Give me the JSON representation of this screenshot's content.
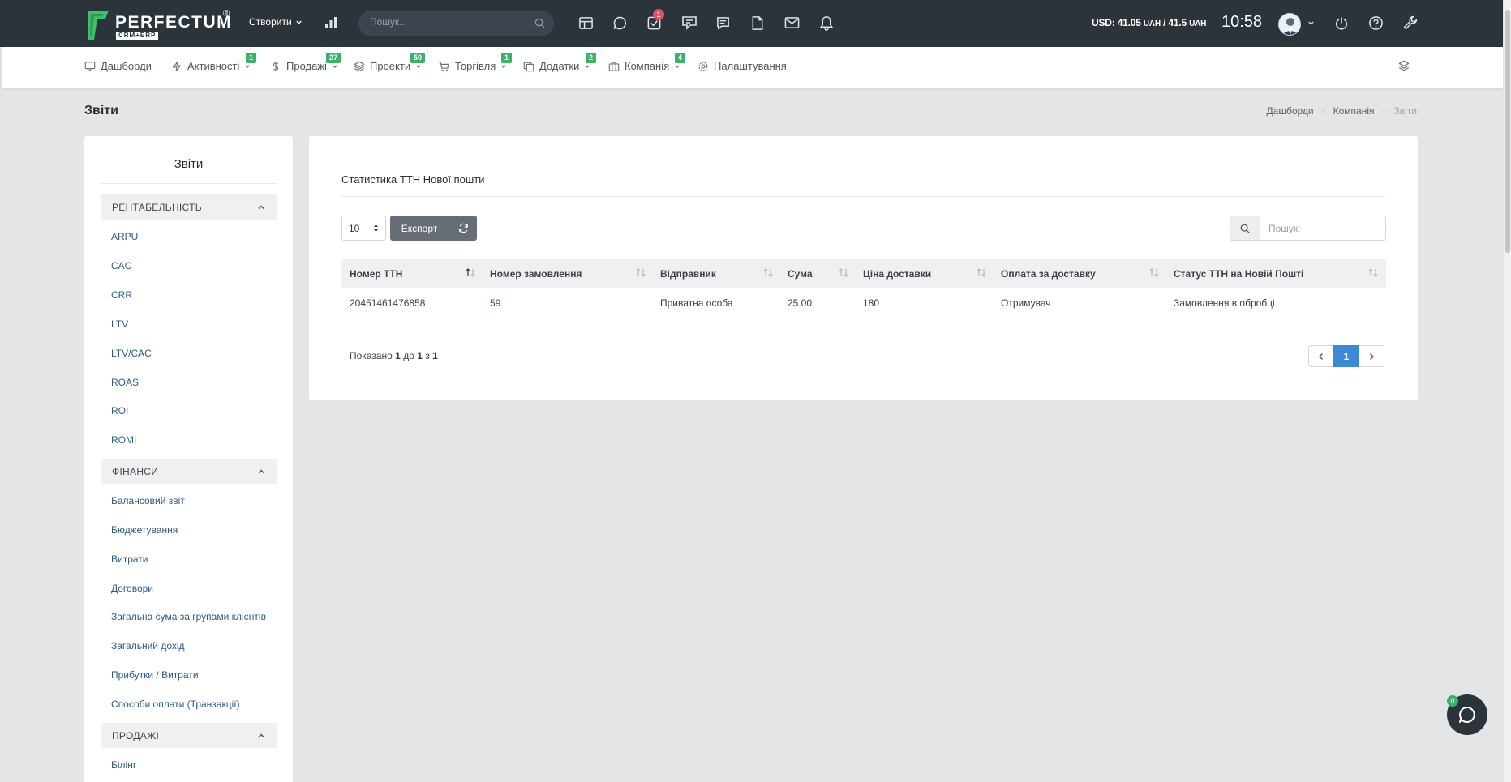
{
  "header": {
    "logo_text": "PERFECTUM",
    "logo_sub": "CRM+ERP",
    "logo_reg": "®",
    "create_label": "Створити",
    "search_placeholder": "Пошук...",
    "tasks_badge": "1",
    "currency_label": "USD:",
    "currency_buy": "41.05",
    "currency_sep": "/",
    "currency_sell": "41.5",
    "currency_unit": "UAH",
    "time": "10:58"
  },
  "nav": [
    {
      "label": "Дашборди",
      "icon": "monitor-icon",
      "badge": ""
    },
    {
      "label": "Активності",
      "icon": "bolt-icon",
      "badge": "1"
    },
    {
      "label": "Продажі",
      "icon": "dollar-icon",
      "badge": "27"
    },
    {
      "label": "Проекти",
      "icon": "layers-icon",
      "badge": "50"
    },
    {
      "label": "Торгівля",
      "icon": "cart-icon",
      "badge": "1"
    },
    {
      "label": "Додатки",
      "icon": "copy-icon",
      "badge": "2"
    },
    {
      "label": "Компанія",
      "icon": "briefcase-icon",
      "badge": "4"
    },
    {
      "label": "Налаштування",
      "icon": "gear-icon",
      "badge": ""
    }
  ],
  "page": {
    "title": "Звіти",
    "breadcrumb": [
      "Дашборди",
      "Компанія",
      "Звіти"
    ]
  },
  "sidebar": {
    "title": "Звіти",
    "groups": [
      {
        "name": "РЕНТАБЕЛЬНІСТЬ",
        "items": [
          "ARPU",
          "CAC",
          "CRR",
          "LTV",
          "LTV/CAC",
          "ROAS",
          "ROI",
          "ROMI"
        ]
      },
      {
        "name": "ФІНАНСИ",
        "items": [
          "Балансовий звіт",
          "Бюджетування",
          "Витрати",
          "Договори",
          "Загальна сума за групами клієнтів",
          "Загальний дохід",
          "Прибутки / Витрати",
          "Способи оплати (Транзакції)"
        ]
      },
      {
        "name": "ПРОДАЖІ",
        "items": [
          "Білінг"
        ]
      }
    ]
  },
  "report": {
    "title": "Статистика ТТН Нової пошти",
    "page_length": "10",
    "export_label": "Експорт",
    "search_placeholder": "Пошук:",
    "columns": [
      "Номер ТТН",
      "Номер замовлення",
      "Відправник",
      "Сума",
      "Ціна доставки",
      "Оплата за доставку",
      "Статус ТТН на Новій Пошті"
    ],
    "rows": [
      [
        "20451461476858",
        "59",
        "Приватна особа",
        "25.00",
        "180",
        "Отримувач",
        "Замовлення в обробці"
      ]
    ],
    "info_prefix": "Показано",
    "info_from": "1",
    "info_to_word": "до",
    "info_to": "1",
    "info_of_word": "з",
    "info_total": "1",
    "current_page": "1"
  },
  "chat": {
    "badge": "0"
  },
  "colors": {
    "topbar": "#2b333b",
    "accent": "#3a8ad6",
    "badge_green": "#3ab26a",
    "badge_red": "#e4505f"
  }
}
